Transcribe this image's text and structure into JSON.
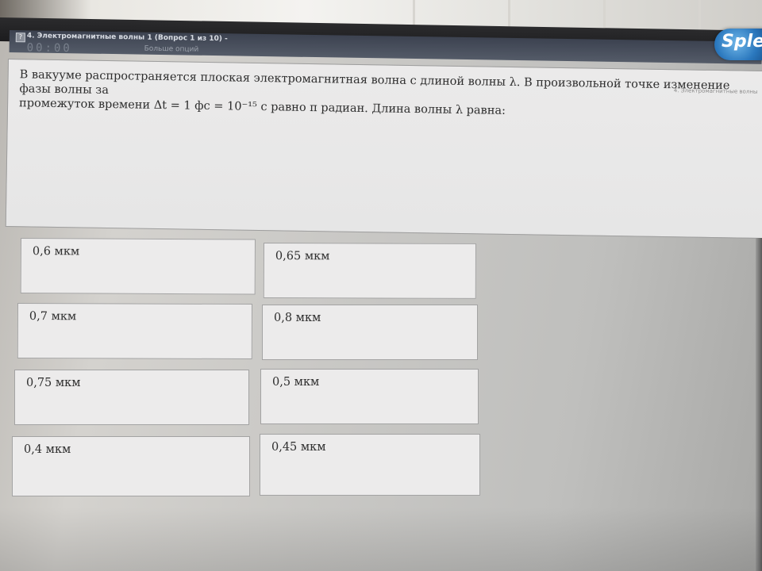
{
  "window": {
    "title": "4. Электромагнитные волны 1 (Вопрос 1 из 10) -",
    "timer": "00:00",
    "sub_caption": "Больше опций",
    "brand": "Sple"
  },
  "question": {
    "panel_caption": "4. Электромагнитные волны",
    "text": "В вакууме распространяется плоская электромагнитная волна с длиной волны λ. В произвольной точке изменение фазы волны за\nпромежуток времени Δt = 1 фс = 10⁻¹⁵ с равно π радиан. Длина волны λ равна:"
  },
  "answers": [
    {
      "label": "0,6 мкм"
    },
    {
      "label": "0,65 мкм"
    },
    {
      "label": "0,7 мкм"
    },
    {
      "label": "0,8 мкм"
    },
    {
      "label": "0,75 мкм"
    },
    {
      "label": "0,5 мкм"
    },
    {
      "label": "0,4 мкм"
    },
    {
      "label": "0,45 мкм"
    }
  ],
  "colors": {
    "titlebar": "#3c4250",
    "panel": "#ebeaea",
    "answer_bg": "#ecebeb",
    "text": "#2e2e2e",
    "brand": "#2a77bd"
  }
}
